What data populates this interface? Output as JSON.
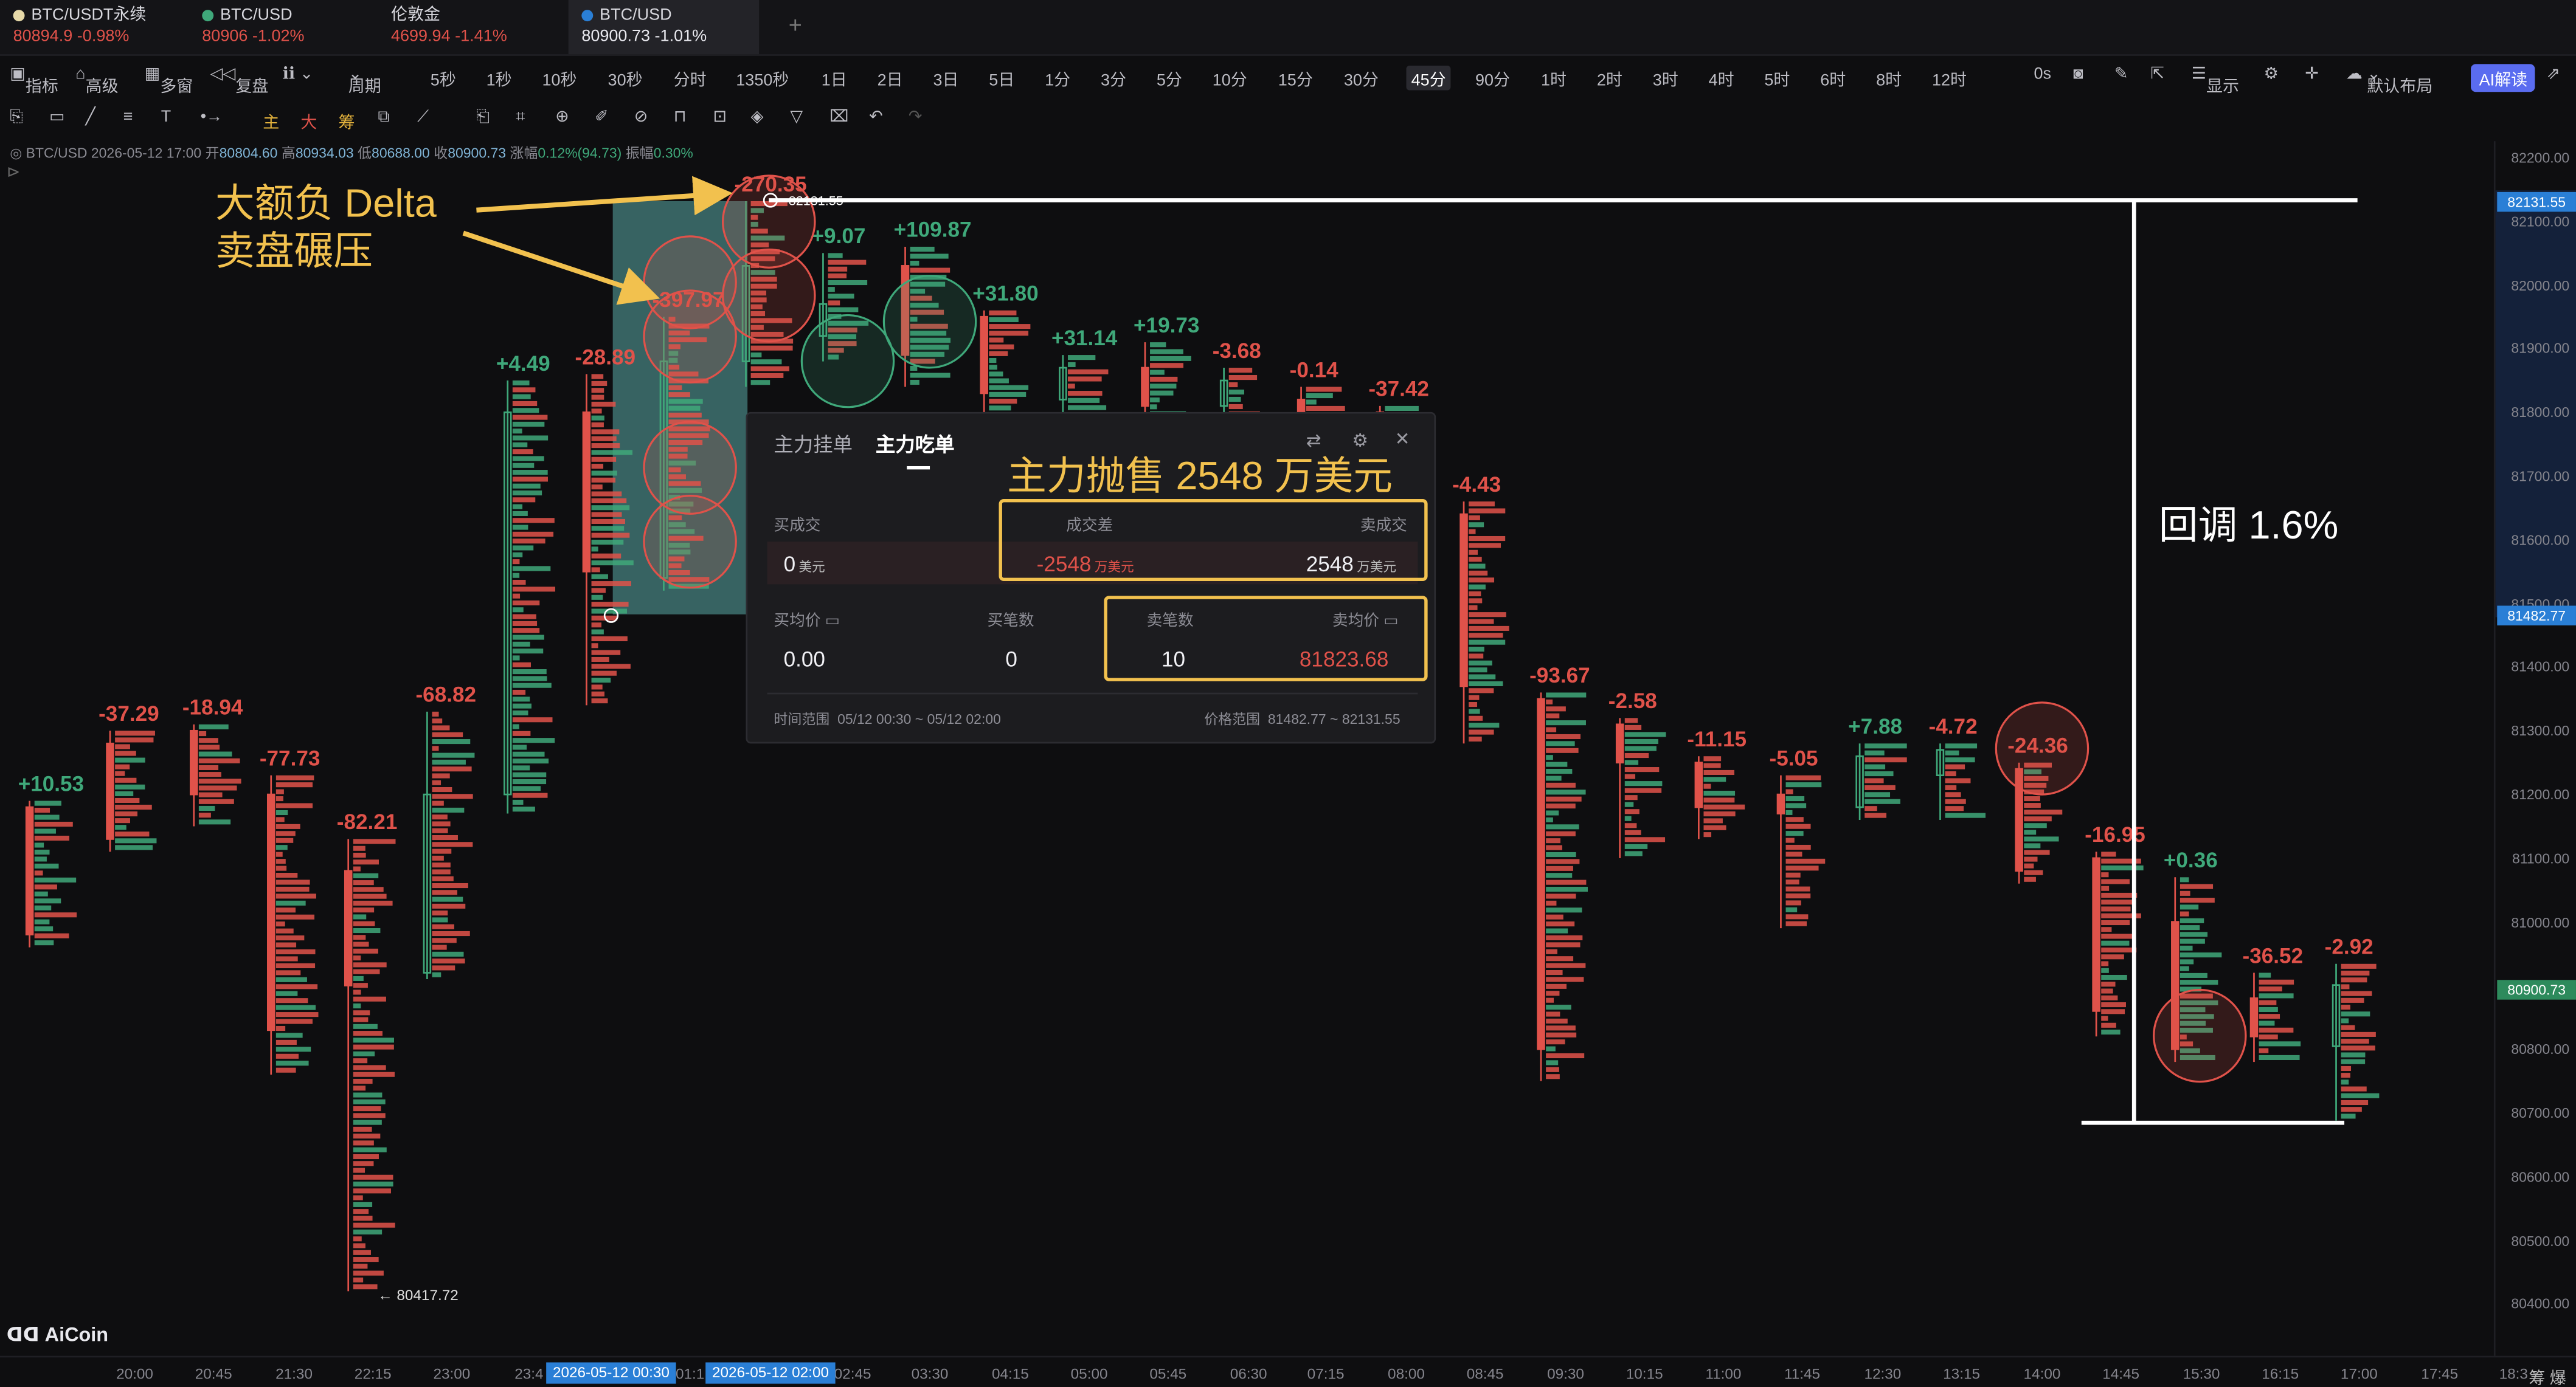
{
  "tabs": [
    {
      "name": "BTC/USDT永续",
      "price": "80894.9",
      "change": "-0.98%",
      "dot": "#e6d9a8"
    },
    {
      "name": "BTC/USD",
      "price": "80906",
      "change": "-1.02%",
      "dot": "#3fa87a"
    },
    {
      "name": "伦敦金",
      "price": "4699.94",
      "change": "-1.41%",
      "dot": ""
    },
    {
      "name": "BTC/USD",
      "price": "80900.73",
      "change": "-1.01%",
      "dot": "#2a7fd6"
    }
  ],
  "toolbar": {
    "indicators": "指标",
    "advanced": "高级",
    "multi_window": "多窗",
    "replay": "复盘",
    "period": "周期",
    "intervals": [
      "5秒",
      "1秒",
      "10秒",
      "30秒",
      "分时",
      "1350秒",
      "1日",
      "2日",
      "3日",
      "5日",
      "1分",
      "3分",
      "5分",
      "10分",
      "15分",
      "30分",
      "45分",
      "90分",
      "1时",
      "2时",
      "3时",
      "4时",
      "5时",
      "6时",
      "8时",
      "12时"
    ],
    "selected_interval": "45分",
    "countdown": "0s",
    "display": "显示",
    "layout": "默认布局",
    "ai": "AI解读"
  },
  "drawbar": {
    "main": "主",
    "big": "大",
    "chip": "筹"
  },
  "ohlc_line": {
    "symbol": "BTC/USD",
    "time": "2026-05-12 17:00",
    "open_label": "开",
    "open": "80804.60",
    "high_label": "高",
    "high": "80934.03",
    "low_label": "低",
    "low": "80688.00",
    "close_label": "收",
    "close": "80900.73",
    "change_label": "涨幅",
    "change": "0.12%(94.73)",
    "amp_label": "振幅",
    "amp": "0.30%"
  },
  "axes": {
    "y_ticks": [
      "82200.00",
      "82100.00",
      "82000.00",
      "81900.00",
      "81800.00",
      "81700.00",
      "81600.00",
      "81500.00",
      "81400.00",
      "81300.00",
      "81200.00",
      "81100.00",
      "81000.00",
      "80900.00",
      "80800.00",
      "80700.00",
      "80600.00",
      "80500.00",
      "80400.00"
    ],
    "y_tags": [
      {
        "text": "82131.55",
        "color": "#2a7fd6"
      },
      {
        "text": "81482.77",
        "color": "#2a7fd6"
      },
      {
        "text": "80900.73",
        "color": "#2d8a5c"
      }
    ],
    "x_ticks": [
      "20:00",
      "20:45",
      "21:30",
      "22:15",
      "23:00",
      "23:4",
      "01:1",
      "02:45",
      "03:30",
      "04:15",
      "05:00",
      "05:45",
      "06:30",
      "07:15",
      "08:00",
      "08:45",
      "09:30",
      "10:15",
      "11:00",
      "11:45",
      "12:30",
      "13:15",
      "14:00",
      "14:45",
      "15:30",
      "16:15",
      "17:00",
      "17:45",
      "18:3"
    ],
    "x_tags": [
      "2026-05-12 00:30",
      "2026-05-12 02:00"
    ],
    "x_end": "筹 爆"
  },
  "chart_data": {
    "type": "bar",
    "title": "",
    "series_name": "footprint delta",
    "low_marker": "← 80417.72",
    "high_marker": "82131.55",
    "candles": [
      {
        "delta": "+10.53",
        "open": 81180,
        "close": 80980,
        "high": 81190,
        "low": 80960
      },
      {
        "delta": "-37.29",
        "open": 81280,
        "close": 81130,
        "high": 81300,
        "low": 81110
      },
      {
        "delta": "-18.94",
        "open": 81300,
        "close": 81200,
        "high": 81310,
        "low": 81150
      },
      {
        "delta": "-77.73",
        "open": 81200,
        "close": 80830,
        "high": 81230,
        "low": 80760
      },
      {
        "delta": "-82.21",
        "open": 81080,
        "close": 80900,
        "high": 81130,
        "low": 80420
      },
      {
        "delta": "-68.82",
        "open": 80920,
        "close": 81200,
        "high": 81330,
        "low": 80910
      },
      {
        "delta": "+4.49",
        "open": 81200,
        "close": 81800,
        "high": 81850,
        "low": 81170
      },
      {
        "delta": "-28.89",
        "open": 81800,
        "close": 81550,
        "high": 81860,
        "low": 81340
      },
      {
        "delta": "-397.97",
        "open": 81540,
        "close": 81880,
        "high": 81950,
        "low": 81520
      },
      {
        "delta": "-270.35",
        "open": 81880,
        "close": 82030,
        "high": 82131.55,
        "low": 81840
      },
      {
        "delta": "+9.07",
        "open": 81920,
        "close": 81970,
        "high": 82050,
        "low": 81880
      },
      {
        "delta": "+109.87",
        "open": 82030,
        "close": 81890,
        "high": 82060,
        "low": 81840
      },
      {
        "delta": "+31.80",
        "open": 81950,
        "close": 81830,
        "high": 81960,
        "low": 81800
      },
      {
        "delta": "+31.14",
        "open": 81820,
        "close": 81870,
        "high": 81890,
        "low": 81800
      },
      {
        "delta": "+19.73",
        "open": 81870,
        "close": 81810,
        "high": 81910,
        "low": 81780
      },
      {
        "delta": "-3.68",
        "open": 81810,
        "close": 81850,
        "high": 81870,
        "low": 81790
      },
      {
        "delta": "-0.14",
        "open": 81820,
        "close": 81800,
        "high": 81840,
        "low": 81780
      },
      {
        "delta": "-37.42",
        "open": 81800,
        "close": 81700,
        "high": 81810,
        "low": 81680
      },
      {
        "delta": "-4.43",
        "open": 81640,
        "close": 81370,
        "high": 81660,
        "low": 81280
      },
      {
        "delta": "-93.67",
        "open": 81350,
        "close": 80800,
        "high": 81360,
        "low": 80750
      },
      {
        "delta": "-2.58",
        "open": 81310,
        "close": 81250,
        "high": 81320,
        "low": 81100
      },
      {
        "delta": "-11.15",
        "open": 81250,
        "close": 81180,
        "high": 81260,
        "low": 81130
      },
      {
        "delta": "-5.05",
        "open": 81200,
        "close": 81170,
        "high": 81230,
        "low": 80990
      },
      {
        "delta": "+7.88",
        "open": 81180,
        "close": 81260,
        "high": 81280,
        "low": 81160
      },
      {
        "delta": "-4.72",
        "open": 81230,
        "close": 81270,
        "high": 81280,
        "low": 81160
      },
      {
        "delta": "-24.36",
        "open": 81240,
        "close": 81080,
        "high": 81250,
        "low": 81060
      },
      {
        "delta": "-16.95",
        "open": 81100,
        "close": 80860,
        "high": 81110,
        "low": 80820
      },
      {
        "delta": "+0.36",
        "open": 81000,
        "close": 80800,
        "high": 81070,
        "low": 80780
      },
      {
        "delta": "-36.52",
        "open": 80880,
        "close": 80820,
        "high": 80920,
        "low": 80780
      },
      {
        "delta": "-2.92",
        "open": 80804.6,
        "close": 80900.73,
        "high": 80934.03,
        "low": 80688.0
      }
    ],
    "ylim": [
      80380,
      82220
    ]
  },
  "annotations": {
    "big_sell": [
      "大额负 Delta",
      "卖盘碾压"
    ],
    "retracement": "回调 1.6%",
    "popup_headline": "主力抛售 2548 万美元"
  },
  "popup": {
    "tab_orders": "主力挂单",
    "tab_taker": "主力吃单",
    "buy_volume_label": "买成交",
    "buy_volume": "0",
    "buy_volume_unit": "美元",
    "delta_label": "成交差",
    "delta": "-2548",
    "delta_unit": "万美元",
    "sell_volume_label": "卖成交",
    "sell_volume": "2548",
    "sell_volume_unit": "万美元",
    "buy_avg_label": "买均价",
    "buy_avg": "0.00",
    "buy_count_label": "买笔数",
    "buy_count": "0",
    "sell_count_label": "卖笔数",
    "sell_count": "10",
    "sell_avg_label": "卖均价",
    "sell_avg": "81823.68",
    "time_range_label": "时间范围",
    "time_range": "05/12 00:30 ~ 05/12 02:00",
    "price_range_label": "价格范围",
    "price_range": "81482.77 ~ 82131.55"
  },
  "brand": "AiCoin",
  "colors": {
    "up": "#3fa87a",
    "down": "#e0524a",
    "accent": "#f2c14e",
    "link": "#2a7fd6"
  }
}
